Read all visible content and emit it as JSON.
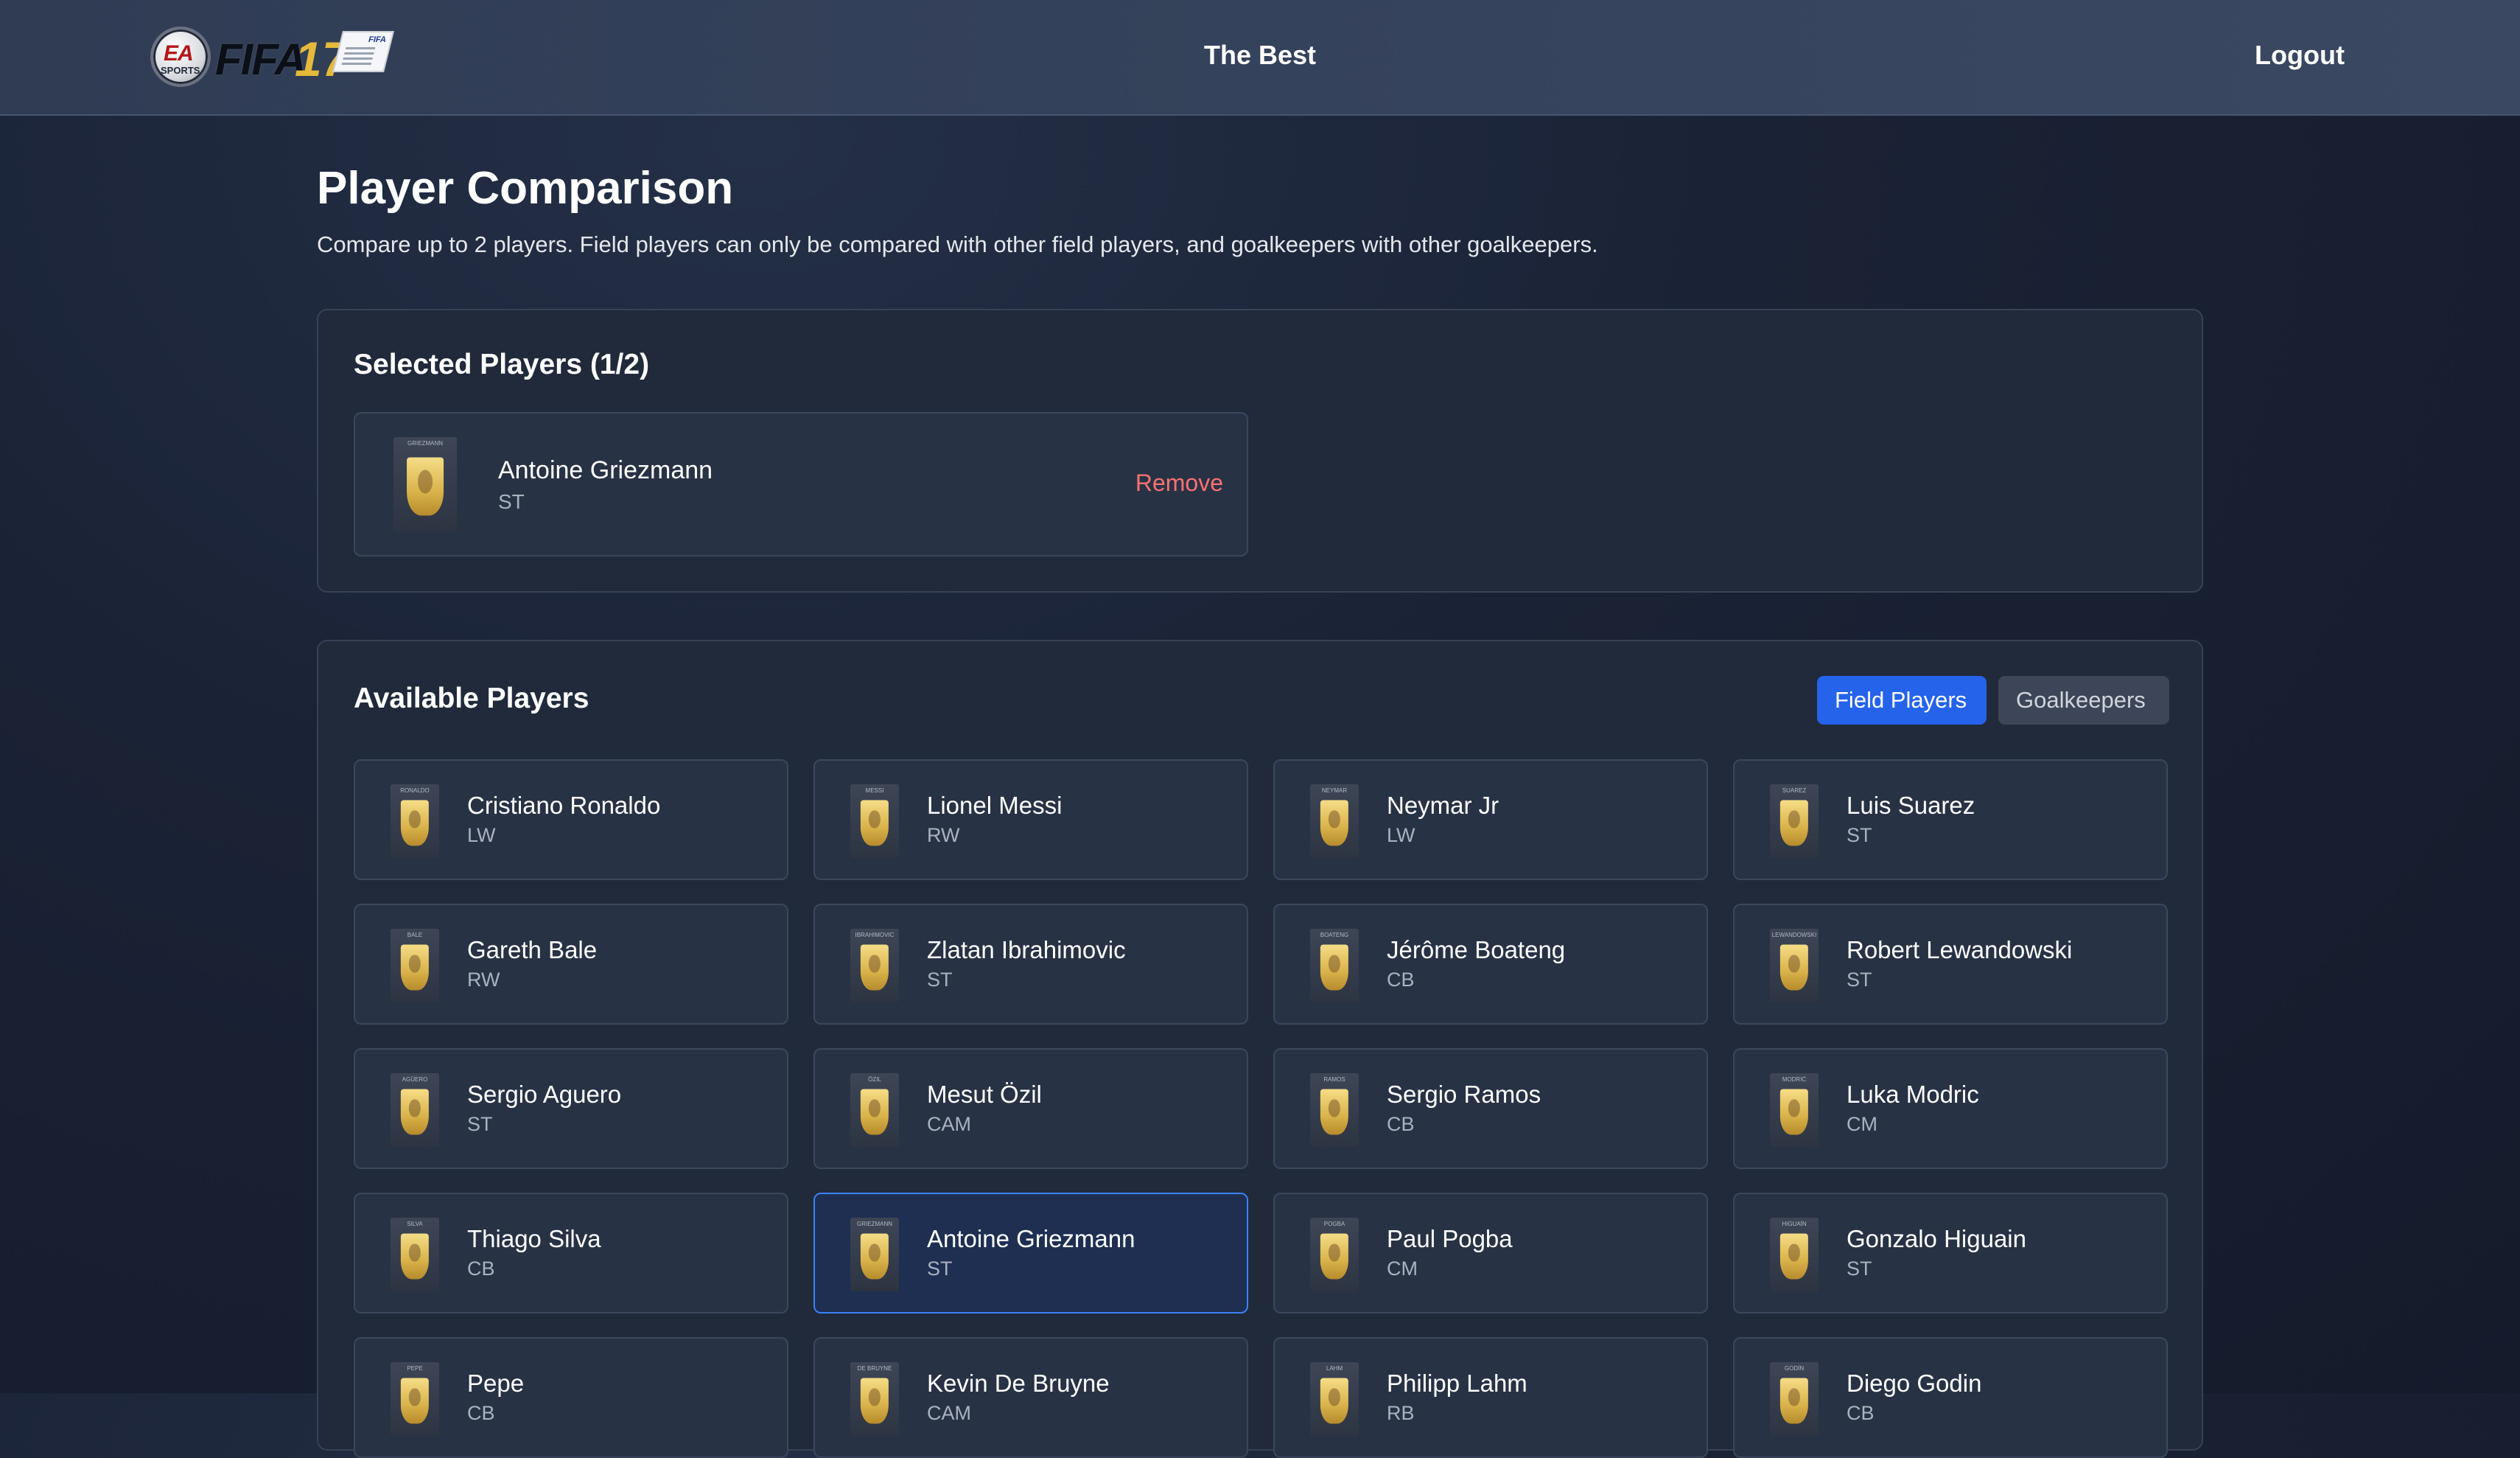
{
  "header": {
    "logo": {
      "ea_text": "EA",
      "sports_text": "SPORTS",
      "game_text": "FIFA",
      "year_text": "17",
      "card_text": "FIFA"
    },
    "brand": "The Best",
    "logout_label": "Logout"
  },
  "page": {
    "title": "Player Comparison",
    "subtitle": "Compare up to 2 players. Field players can only be compared with other field players, and goalkeepers with other goalkeepers."
  },
  "selected": {
    "heading": "Selected Players (1/2)",
    "players": [
      {
        "name": "Antoine Griezmann",
        "position": "ST",
        "card_tag": "GRIEZMANN",
        "remove_label": "Remove"
      }
    ]
  },
  "available": {
    "heading": "Available Players",
    "tabs": [
      {
        "label": "Field Players",
        "active": true
      },
      {
        "label": "Goalkeepers",
        "active": false
      }
    ],
    "players": [
      {
        "name": "Cristiano Ronaldo",
        "position": "LW",
        "card_tag": "RONALDO"
      },
      {
        "name": "Lionel Messi",
        "position": "RW",
        "card_tag": "MESSI"
      },
      {
        "name": "Neymar Jr",
        "position": "LW",
        "card_tag": "NEYMAR"
      },
      {
        "name": "Luis Suarez",
        "position": "ST",
        "card_tag": "SUAREZ"
      },
      {
        "name": "Gareth Bale",
        "position": "RW",
        "card_tag": "BALE"
      },
      {
        "name": "Zlatan Ibrahimovic",
        "position": "ST",
        "card_tag": "IBRAHIMOVIC"
      },
      {
        "name": "Jérôme Boateng",
        "position": "CB",
        "card_tag": "BOATENG"
      },
      {
        "name": "Robert Lewandowski",
        "position": "ST",
        "card_tag": "LEWANDOWSKI"
      },
      {
        "name": "Sergio Aguero",
        "position": "ST",
        "card_tag": "AGÜERO"
      },
      {
        "name": "Mesut Özil",
        "position": "CAM",
        "card_tag": "ÖZIL"
      },
      {
        "name": "Sergio Ramos",
        "position": "CB",
        "card_tag": "RAMOS"
      },
      {
        "name": "Luka Modric",
        "position": "CM",
        "card_tag": "MODRIĆ"
      },
      {
        "name": "Thiago Silva",
        "position": "CB",
        "card_tag": "SILVA"
      },
      {
        "name": "Antoine Griezmann",
        "position": "ST",
        "card_tag": "GRIEZMANN",
        "selected": true
      },
      {
        "name": "Paul Pogba",
        "position": "CM",
        "card_tag": "POGBA"
      },
      {
        "name": "Gonzalo Higuain",
        "position": "ST",
        "card_tag": "HIGUAÍN"
      },
      {
        "name": "Pepe",
        "position": "CB",
        "card_tag": "PEPE"
      },
      {
        "name": "Kevin De Bruyne",
        "position": "CAM",
        "card_tag": "DE BRUYNE"
      },
      {
        "name": "Philipp Lahm",
        "position": "RB",
        "card_tag": "LAHM"
      },
      {
        "name": "Diego Godin",
        "position": "CB",
        "card_tag": "GODÍN"
      }
    ]
  },
  "colors": {
    "accent": "#2563eb",
    "remove": "#f87171",
    "selected_border": "#3b82f6",
    "panel": "#212a3b",
    "card": "#283245"
  }
}
